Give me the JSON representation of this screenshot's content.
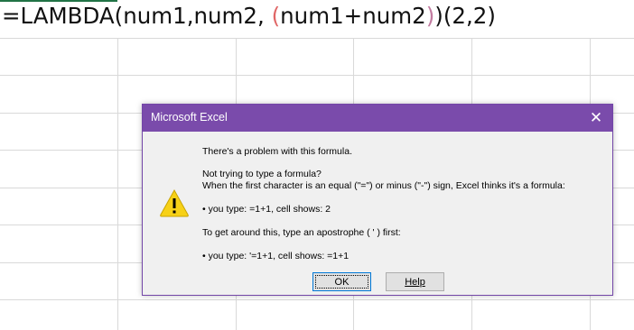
{
  "formula": {
    "prefix": "=LAMBDA(num1,num2, ",
    "open_paren": "(",
    "body": "num1+num2",
    "close_paren": ")",
    "suffix": ")(2,2)"
  },
  "dialog": {
    "title": "Microsoft Excel",
    "icon": "warning-icon",
    "lines": [
      "There's a problem with this formula.",
      "Not trying to type a formula?",
      "When the first character is an equal (\"=\") or minus (\"-\") sign, Excel thinks it's a formula:",
      "• you type:   =1+1, cell shows:   2",
      "To get around this, type an apostrophe ( ' ) first:",
      "• you type:   '=1+1, cell shows:   =1+1"
    ],
    "ok_label": "OK",
    "help_label": "Help"
  },
  "colors": {
    "titlebar": "#7a4bab",
    "paren_highlight": "#e06666",
    "grid": "#d9d9d9",
    "active_cell": "#217346"
  }
}
